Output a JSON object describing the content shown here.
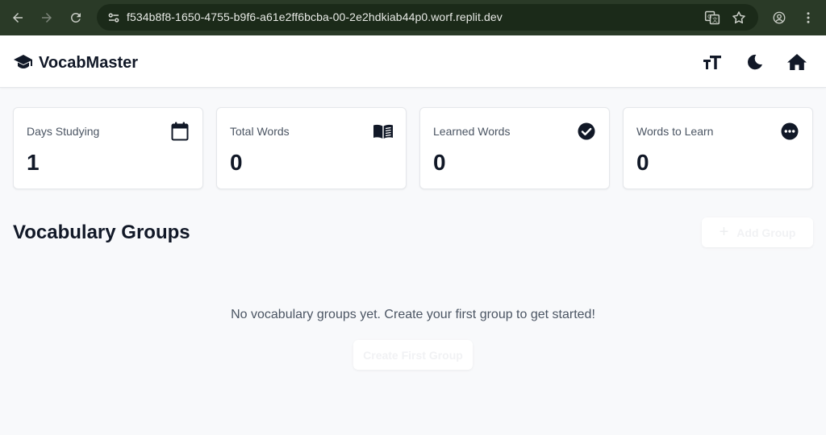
{
  "browser": {
    "url": "f534b8f8-1650-4755-b9f6-a61e2ff6bcba-00-2e2hdkiab44p0.worf.replit.dev",
    "icons": [
      "back-arrow-icon",
      "forward-arrow-icon",
      "reload-icon",
      "site-info-icon",
      "translate-icon",
      "bookmark-star-icon",
      "profile-icon",
      "kebab-menu-icon"
    ]
  },
  "header": {
    "brand": "VocabMaster",
    "icons": [
      "graduation-cap-icon",
      "text-size-icon",
      "moon-icon",
      "home-icon"
    ]
  },
  "stats": [
    {
      "label": "Days Studying",
      "value": "1",
      "icon": "calendar-icon"
    },
    {
      "label": "Total Words",
      "value": "0",
      "icon": "open-book-icon"
    },
    {
      "label": "Learned Words",
      "value": "0",
      "icon": "check-circle-icon"
    },
    {
      "label": "Words to Learn",
      "value": "0",
      "icon": "ellipsis-circle-icon"
    }
  ],
  "groups": {
    "title": "Vocabulary Groups",
    "add_button_label": "Add Group",
    "add_button_icon": "+",
    "empty_message": "No vocabulary groups yet. Create your first group to get started!",
    "create_first_label": "Create First Group"
  },
  "colors": {
    "browser_bar": "#2a3a27",
    "omnibox": "#1b2a19",
    "page_bg": "#f8f9fb",
    "text_primary": "#111827",
    "text_muted": "#4b5563"
  }
}
